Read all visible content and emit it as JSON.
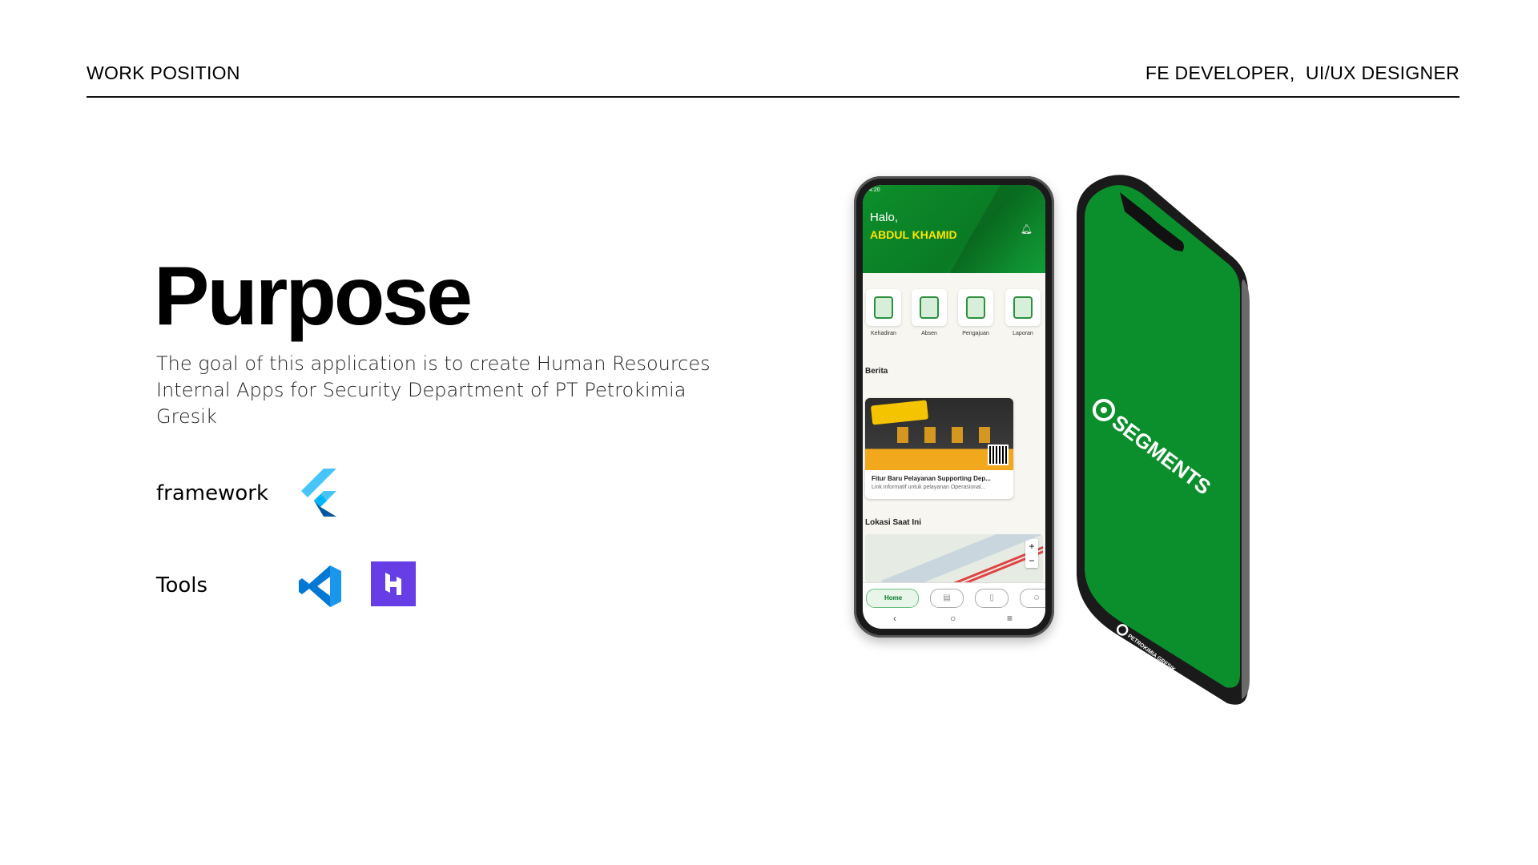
{
  "header": {
    "left_label": "WORK POSITION",
    "right_label": "FE DEVELOPER,  UI/UX DESIGNER"
  },
  "main": {
    "title": "Purpose",
    "description": "The goal of this application is to create Human Resources Internal Apps for Security Department of PT Petrokimia Gresik",
    "framework_label": "framework",
    "tools_label": "Tools"
  },
  "icons": {
    "framework": [
      "flutter-icon"
    ],
    "tools": [
      "vscode-icon",
      "hostinger-icon"
    ]
  },
  "colors": {
    "flutter_light": "#47C5FB",
    "flutter_dark": "#00569E",
    "vscode": "#0065A9",
    "hostinger": "#673DE6",
    "app_green": "#0B8F2C",
    "app_yellow": "#FFE600"
  },
  "phone_app": {
    "statusbar": "4:20",
    "greeting": "Halo,",
    "user_name": "ABDUL KHAMID",
    "menu": [
      "Kehadiran",
      "Absen",
      "Pengajuan",
      "Laporan"
    ],
    "news_section": "Berita",
    "news_title": "Fitur Baru Pelayanan Supporting Dep...",
    "news_sub": "Link informatif untuk pelayanan Operasional...",
    "location_section": "Lokasi Saat Ini",
    "nav_home": "Home",
    "zoom_in": "+",
    "zoom_out": "−"
  },
  "splash": {
    "brand": "SEGMENTS",
    "company": "PETROKIMIA GRESIK"
  }
}
